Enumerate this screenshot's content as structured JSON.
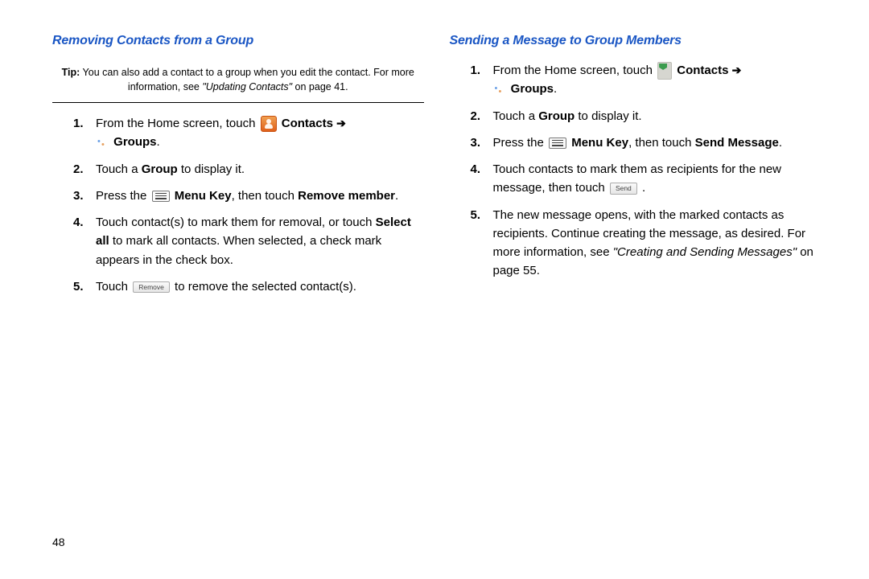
{
  "left": {
    "heading": "Removing Contacts from a Group",
    "tip_label": "Tip:",
    "tip_body": " You can also add a contact to a group when you edit the contact. For more information, see ",
    "tip_ref": "\"Updating Contacts\"",
    "tip_tail": " on page 41.",
    "s1a": "From the Home screen, touch ",
    "s1_contacts": "Contacts",
    "s1_arrow": " ➔ ",
    "s1_groups": "Groups",
    "s1_tail": ".",
    "s2a": "Touch a ",
    "s2_group": "Group",
    "s2b": " to display it.",
    "s3a": "Press the ",
    "s3_menu": "Menu Key",
    "s3b": ", then touch ",
    "s3_remove": "Remove member",
    "s3c": ".",
    "s4a": "Touch contact(s) to mark them for removal, or touch ",
    "s4_sel": "Select all",
    "s4b": " to mark all contacts. When selected, a check mark appears in the check box.",
    "s5a": "Touch ",
    "s5_btn": "Remove",
    "s5b": " to remove the selected contact(s)."
  },
  "right": {
    "heading": "Sending a Message to Group Members",
    "s1a": "From the Home screen, touch ",
    "s1_contacts": "Contacts",
    "s1_arrow": " ➔ ",
    "s1_groups": "Groups",
    "s1_tail": ".",
    "s2a": "Touch a ",
    "s2_group": "Group",
    "s2b": " to display it.",
    "s3a": "Press the ",
    "s3_menu": "Menu Key",
    "s3b": ", then touch ",
    "s3_send": "Send Message",
    "s3c": ".",
    "s4a": "Touch contacts to mark them as recipients for the new message, then touch ",
    "s4_btn": "Send",
    "s4b": " .",
    "s5a": "The new message opens, with the marked contacts as recipients. Continue creating the message, as desired. For more information, see ",
    "s5_ref": "\"Creating and Sending Messages\"",
    "s5b": " on page 55."
  },
  "page_number": "48"
}
